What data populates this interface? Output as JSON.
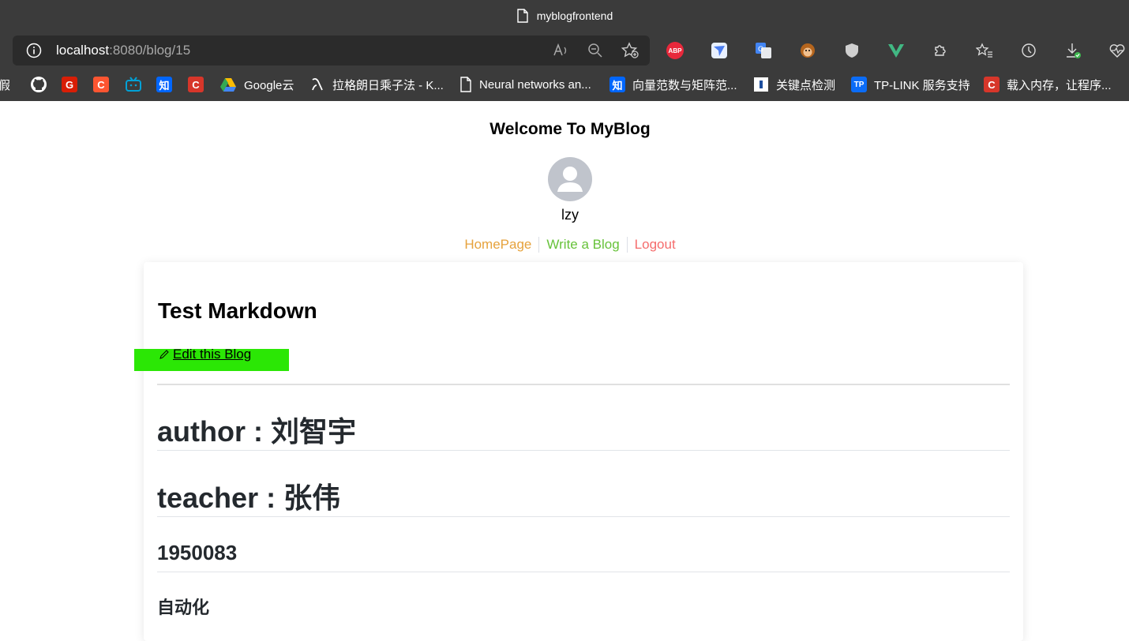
{
  "window": {
    "title": "myblogfrontend"
  },
  "address_bar": {
    "host": "localhost",
    "rest": ":8080/blog/15"
  },
  "extensions": [
    "abp-icon",
    "paper-plane-icon",
    "google-translate-icon",
    "monkey-icon",
    "shield-icon",
    "vue-icon",
    "puzzle-icon",
    "favorites-icon",
    "history-icon",
    "download-icon",
    "heartbeat-icon"
  ],
  "abp_label": "ABP",
  "bookmarks": [
    {
      "label": "假",
      "icon": "text-icon"
    },
    {
      "label": "",
      "icon": "github-icon"
    },
    {
      "label": "",
      "icon": "g-icon"
    },
    {
      "label": "",
      "icon": "csdn-icon"
    },
    {
      "label": "",
      "icon": "bilibili-icon"
    },
    {
      "label": "",
      "icon": "zhihu-icon"
    },
    {
      "label": "",
      "icon": "csdn-icon"
    },
    {
      "label": "Google云",
      "icon": "google-drive-icon"
    },
    {
      "label": "拉格朗日乘子法 - K...",
      "icon": "script-icon"
    },
    {
      "label": "Neural networks an...",
      "icon": "page-icon"
    },
    {
      "label": "向量范数与矩阵范...",
      "icon": "zhihu-icon"
    },
    {
      "label": "关键点检测",
      "icon": "keypoint-icon"
    },
    {
      "label": "TP-LINK 服务支持",
      "icon": "tplink-icon"
    },
    {
      "label": "载入内存，让程序...",
      "icon": "csdn-icon"
    }
  ],
  "favicon_text": {
    "zhihu": "知",
    "csdn": "C",
    "g": "G",
    "tplink": "TP"
  },
  "page": {
    "title": "Welcome To MyBlog",
    "username": "lzy",
    "nav": {
      "home": "HomePage",
      "write": "Write a Blog",
      "logout": "Logout"
    },
    "nav_colors": {
      "home": "#e6a23c",
      "write": "#67c23a",
      "logout": "#f56c6c"
    }
  },
  "blog": {
    "title": "Test Markdown",
    "edit_label": "Edit this Blog",
    "author_prefix": "author : ",
    "author_name": "刘智宇",
    "teacher_prefix": "teacher : ",
    "teacher_name": "张伟",
    "student_id": "1950083",
    "major": "自动化"
  }
}
